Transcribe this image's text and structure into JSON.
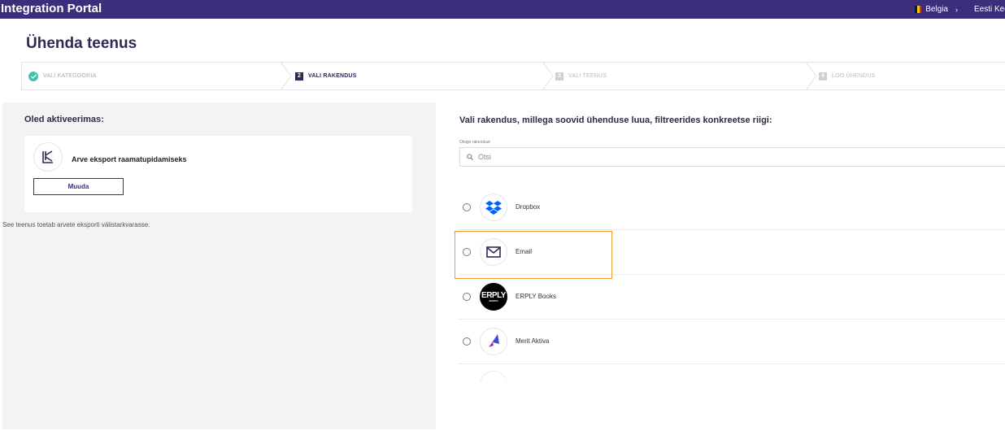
{
  "topbar": {
    "brand": "Integration Portal",
    "country": "Belgia",
    "language": "Eesti Keel"
  },
  "page": {
    "title": "Ühenda teenus"
  },
  "stepper": {
    "steps": [
      {
        "num": "✓",
        "label": "VALI KATEGOORIA",
        "state": "done"
      },
      {
        "num": "2",
        "label": "VALI RAKENDUS",
        "state": "active"
      },
      {
        "num": "3",
        "label": "VALI TEENUS",
        "state": "pending"
      },
      {
        "num": "4",
        "label": "LOO ÜHENDUS",
        "state": "pending"
      }
    ]
  },
  "left": {
    "heading": "Oled aktiveerimas:",
    "service_name": "Arve eksport raamatupidamiseks",
    "change_button": "Muuda",
    "note": "See teenus toetab arvete eksporti välistarkvarasse."
  },
  "right": {
    "heading": "Vali rakendus, millega soovid ühenduse luua, filtreerides konkreetse riigi:",
    "search_label": "Otsige rakendust",
    "search_placeholder": "Otsi",
    "apps": [
      {
        "name": "Dropbox",
        "icon": "dropbox-icon"
      },
      {
        "name": "Email",
        "icon": "mail-icon"
      },
      {
        "name": "ERPLY Books",
        "icon": "erply-books-logo",
        "logo_text": "ERPLY",
        "logo_subtext": "BOOKS"
      },
      {
        "name": "Merit Aktiva",
        "icon": "merit-aktiva-logo"
      }
    ]
  },
  "colors": {
    "header": "#3a2f7a",
    "highlight": "#f29a36",
    "step_done": "#3fc4b4",
    "dropbox": "#0061fe"
  }
}
